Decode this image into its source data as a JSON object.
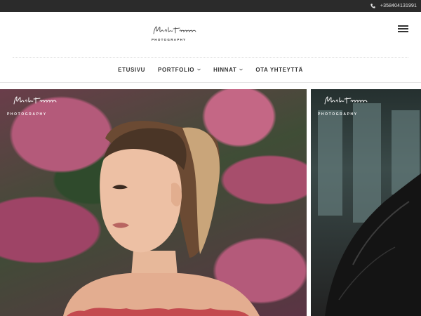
{
  "topbar": {
    "phone": "+358404131991",
    "phone_icon": "phone-icon"
  },
  "header": {
    "logo_script": "Mika Tuomanen",
    "logo_sub": "PHOTOGRAPHY",
    "menu_icon": "hamburger-icon"
  },
  "nav": {
    "items": [
      {
        "label": "ETUSIVU",
        "has_dropdown": false
      },
      {
        "label": "PORTFOLIO",
        "has_dropdown": true
      },
      {
        "label": "HINNAT",
        "has_dropdown": true
      },
      {
        "label": "OTA YHTEYTTÄ",
        "has_dropdown": false
      }
    ]
  },
  "gallery": {
    "photo1": {
      "watermark_script": "Mika Tuomanen",
      "watermark_sub": "PHOTOGRAPHY"
    },
    "photo2": {
      "watermark_script": "Mika Tuomanen",
      "watermark_sub": "PHOTOGRAPHY"
    }
  },
  "colors": {
    "topbar": "#2b2b2b",
    "text": "#333333",
    "background": "#ffffff"
  }
}
